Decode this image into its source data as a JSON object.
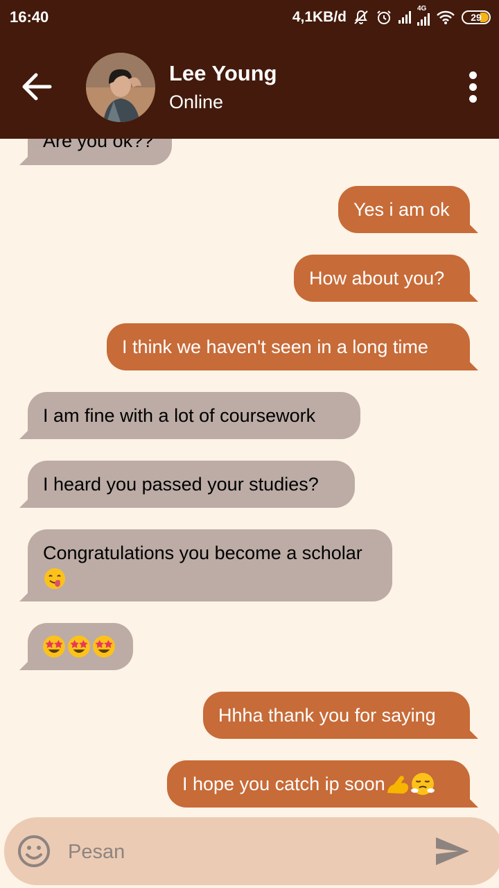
{
  "status": {
    "time": "16:40",
    "speed": "4,1KB/d",
    "network": "4G",
    "battery": "29"
  },
  "header": {
    "name": "Lee Young",
    "status": "Online"
  },
  "messages": [
    {
      "side": "in",
      "text": "Are you ok??"
    },
    {
      "side": "out",
      "text": "Yes i am ok"
    },
    {
      "side": "out",
      "text": "How about you?"
    },
    {
      "side": "out",
      "text": "I think we haven't seen in a long time"
    },
    {
      "side": "in",
      "text": "I am fine with a lot of coursework"
    },
    {
      "side": "in",
      "text": "I heard you passed your studies?"
    },
    {
      "side": "in",
      "text": "Congratulations you become a scholar",
      "emojis": [
        "yum-face"
      ]
    },
    {
      "side": "in",
      "text": "",
      "emojis": [
        "star-struck",
        "star-struck",
        "star-struck"
      ]
    },
    {
      "side": "out",
      "text": "Hhha thank you for saying"
    },
    {
      "side": "out",
      "text": "I hope you catch ip soon",
      "emojis": [
        "flexed-biceps",
        "steam-face"
      ]
    }
  ],
  "composer": {
    "placeholder": "Pesan"
  },
  "colors": {
    "header_bg": "#431a0b",
    "chat_bg": "#fdf3e6",
    "incoming_bubble": "#bcaca5",
    "outgoing_bubble": "#c76b38",
    "composer_bg": "#eccbb4"
  }
}
